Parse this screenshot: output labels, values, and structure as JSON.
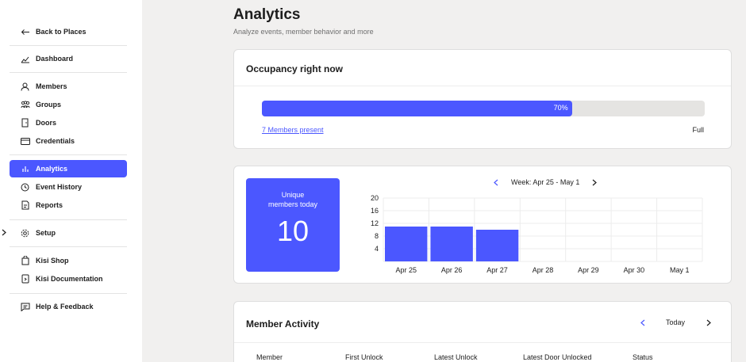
{
  "sidebar": {
    "back": "Back to Places",
    "dashboard": "Dashboard",
    "members": "Members",
    "groups": "Groups",
    "doors": "Doors",
    "credentials": "Credentials",
    "analytics": "Analytics",
    "event_history": "Event History",
    "reports": "Reports",
    "setup": "Setup",
    "kisi_shop": "Kisi Shop",
    "kisi_docs": "Kisi Documentation",
    "help": "Help & Feedback",
    "active_color": "#4b57ff"
  },
  "header": {
    "title": "Analytics",
    "subtitle": "Analyze events, member behavior and more"
  },
  "occupancy": {
    "title": "Occupancy right now",
    "percent_label": "70%",
    "fraction": 0.7,
    "members_link": "7 Members present",
    "full_label": "Full"
  },
  "unique": {
    "label_line1": "Unique",
    "label_line2": "members today",
    "value": "10"
  },
  "week_nav": {
    "label": "Week: Apr 25 - May 1",
    "prev_icon": "chevron-left-icon",
    "next_icon": "chevron-right-icon"
  },
  "chart_data": {
    "type": "bar",
    "categories": [
      "Apr 25",
      "Apr 26",
      "Apr 27",
      "Apr 28",
      "Apr 29",
      "Apr 30",
      "May 1"
    ],
    "values": [
      11,
      11,
      10,
      0,
      0,
      0,
      0
    ],
    "yticks": [
      4,
      8,
      12,
      16,
      20
    ],
    "ylim": [
      0,
      20
    ],
    "grid": true,
    "bar_color": "#4b57ff"
  },
  "activity": {
    "title": "Member Activity",
    "today_label": "Today",
    "columns": [
      "Member",
      "First Unlock",
      "Latest Unlock",
      "Latest Door Unlocked",
      "Status"
    ]
  }
}
